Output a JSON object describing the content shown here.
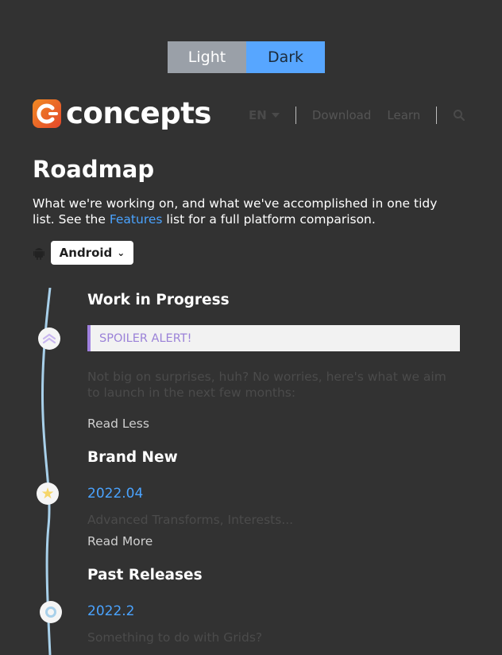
{
  "theme_toggle": {
    "light_label": "Light",
    "dark_label": "Dark"
  },
  "logo": {
    "text": "concepts"
  },
  "nav": {
    "language": "EN",
    "download": "Download",
    "learn": "Learn"
  },
  "page": {
    "title": "Roadmap",
    "intro_before": "What we're working on, and what we've accomplished in one tidy list. See the ",
    "intro_link": "Features",
    "intro_after": " list for a full platform comparison."
  },
  "platform": {
    "selected": "Android"
  },
  "sections": {
    "wip": {
      "title": "Work in Progress",
      "spoiler": "SPOILER ALERT!",
      "description": "Not big on surprises, huh? No worries, here's what we aim to launch in the next few months:",
      "toggle": "Read Less"
    },
    "brand_new": {
      "title": "Brand New",
      "version": "2022.04",
      "description": "Advanced Transforms, Interests...",
      "toggle": "Read More"
    },
    "past": {
      "title": "Past Releases",
      "version": "2022.2",
      "description": "Something to do with Grids?"
    }
  },
  "colors": {
    "background": "#323232",
    "accent": "#57a6ff",
    "link": "#4aa3ff",
    "spoiler_border": "#a081e0",
    "timeline_line": "#a8d0ea",
    "star": "#f5d66b"
  },
  "icons": {
    "logo": "concepts-logo-icon",
    "search": "search-icon",
    "platform": "android-icon",
    "wip_marker": "chevrons-up-icon",
    "new_marker": "star-icon",
    "past_marker": "ring-icon"
  }
}
